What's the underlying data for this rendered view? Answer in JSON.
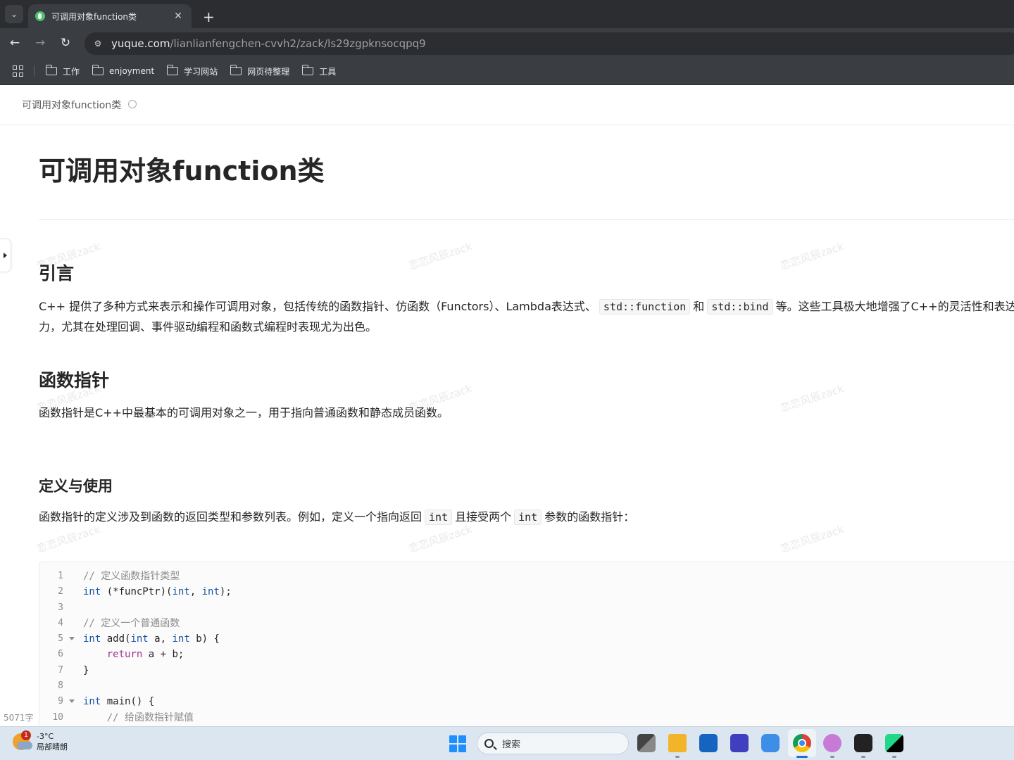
{
  "browser": {
    "tab": {
      "title": "可调用对象function类"
    },
    "new_tab_glyph": "+",
    "url": {
      "host": "yuque.com",
      "path": "/lianlianfengchen-cvvh2/zack/ls29zgpknsocqpq9"
    },
    "bookmarks": [
      {
        "label": "工作"
      },
      {
        "label": "enjoyment"
      },
      {
        "label": "学习网站"
      },
      {
        "label": "网页待整理"
      },
      {
        "label": "工具"
      }
    ]
  },
  "doc": {
    "breadcrumb": "可调用对象function类",
    "title": "可调用对象function类",
    "watermark": "恋恋风辰zack",
    "sections": {
      "intro": {
        "heading": "引言",
        "line1_a": "C++ 提供了多种方式来表示和操作可调用对象，包括传统的函数指针、仿函数（Functors）、Lambda表达式、",
        "code1": "std::function",
        "line1_b": "和",
        "code2": "std::bind",
        "line1_c": "等。这些工具极大地增强了C++的灵活性和表达力",
        "line2": "力，尤其在处理回调、事件驱动编程和函数式编程时表现尤为出色。"
      },
      "fp": {
        "heading": "函数指针",
        "text": "函数指针是C++中最基本的可调用对象之一，用于指向普通函数和静态成员函数。"
      },
      "def": {
        "heading": "定义与使用",
        "text_a": "函数指针的定义涉及到函数的返回类型和参数列表。例如，定义一个指向返回",
        "code1": "int",
        "text_b": "且接受两个",
        "code2": "int",
        "text_c": "参数的函数指针："
      }
    },
    "code_lines": [
      {
        "n": "1",
        "text": "// 定义函数指针类型"
      },
      {
        "n": "2",
        "text": "int (*funcPtr)(int, int);"
      },
      {
        "n": "3",
        "text": ""
      },
      {
        "n": "4",
        "text": "// 定义一个普通函数"
      },
      {
        "n": "5",
        "text": "int add(int a, int b) {"
      },
      {
        "n": "6",
        "text": "    return a + b;"
      },
      {
        "n": "7",
        "text": "}"
      },
      {
        "n": "8",
        "text": ""
      },
      {
        "n": "9",
        "text": "int main() {"
      },
      {
        "n": "10",
        "text": "    // 给函数指针赋值"
      }
    ],
    "word_count": "5071字"
  },
  "taskbar": {
    "weather_badge": "1",
    "temperature": "-3°C",
    "condition": "局部晴朗",
    "search_placeholder": "搜索"
  },
  "colors": {
    "accent": "#1f6fd1",
    "chrome_bg": "#3a3d41",
    "code_keyword": "#1a55a6",
    "code_return": "#a6308a"
  }
}
